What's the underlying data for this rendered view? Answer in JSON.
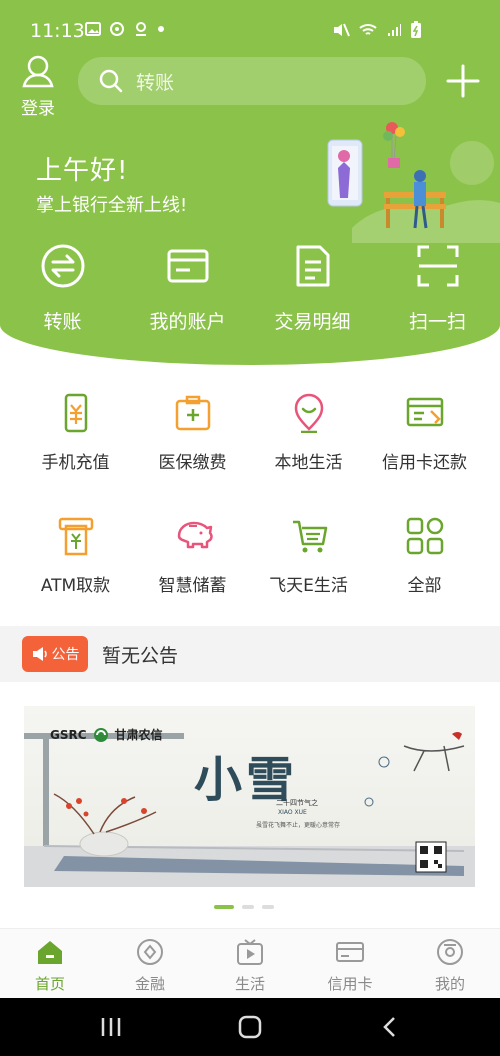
{
  "status": {
    "time": "11:13"
  },
  "header": {
    "login_label": "登录",
    "search_placeholder": "转账",
    "greeting": "上午好!",
    "subtitle": "掌上银行全新上线!"
  },
  "quick_actions": [
    {
      "label": "转账",
      "icon": "transfer-icon"
    },
    {
      "label": "我的账户",
      "icon": "account-card-icon"
    },
    {
      "label": "交易明细",
      "icon": "document-icon"
    },
    {
      "label": "扫一扫",
      "icon": "scan-icon"
    }
  ],
  "services": [
    {
      "label": "手机充值",
      "icon": "phone-recharge-icon"
    },
    {
      "label": "医保缴费",
      "icon": "medical-insurance-icon"
    },
    {
      "label": "本地生活",
      "icon": "location-pin-icon"
    },
    {
      "label": "信用卡还款",
      "icon": "credit-card-repay-icon"
    },
    {
      "label": "ATM取款",
      "icon": "atm-icon"
    },
    {
      "label": "智慧储蓄",
      "icon": "piggy-bank-icon"
    },
    {
      "label": "飞天E生活",
      "icon": "shopping-cart-icon"
    },
    {
      "label": "全部",
      "icon": "grid-all-icon"
    }
  ],
  "notice": {
    "badge": "公告",
    "text": "暂无公告"
  },
  "banner": {
    "brand": "GSRC",
    "brand_cn": "甘肃农信",
    "title": "小雪",
    "caption": "二十四节气之",
    "caption_en": "XIAO XUE",
    "caption_small": "虽雪花飞舞不止，更暖心意常存"
  },
  "tabs": [
    {
      "label": "首页",
      "icon": "home-icon",
      "active": true
    },
    {
      "label": "金融",
      "icon": "finance-icon",
      "active": false
    },
    {
      "label": "生活",
      "icon": "life-play-icon",
      "active": false
    },
    {
      "label": "信用卡",
      "icon": "credit-card-icon",
      "active": false
    },
    {
      "label": "我的",
      "icon": "profile-icon",
      "active": false
    }
  ],
  "colors": {
    "brand_green": "#8bc34a",
    "icon_green": "#6aa52e",
    "accent_orange": "#f4a031",
    "accent_pink": "#e8557a",
    "notice_red": "#f4623a"
  }
}
